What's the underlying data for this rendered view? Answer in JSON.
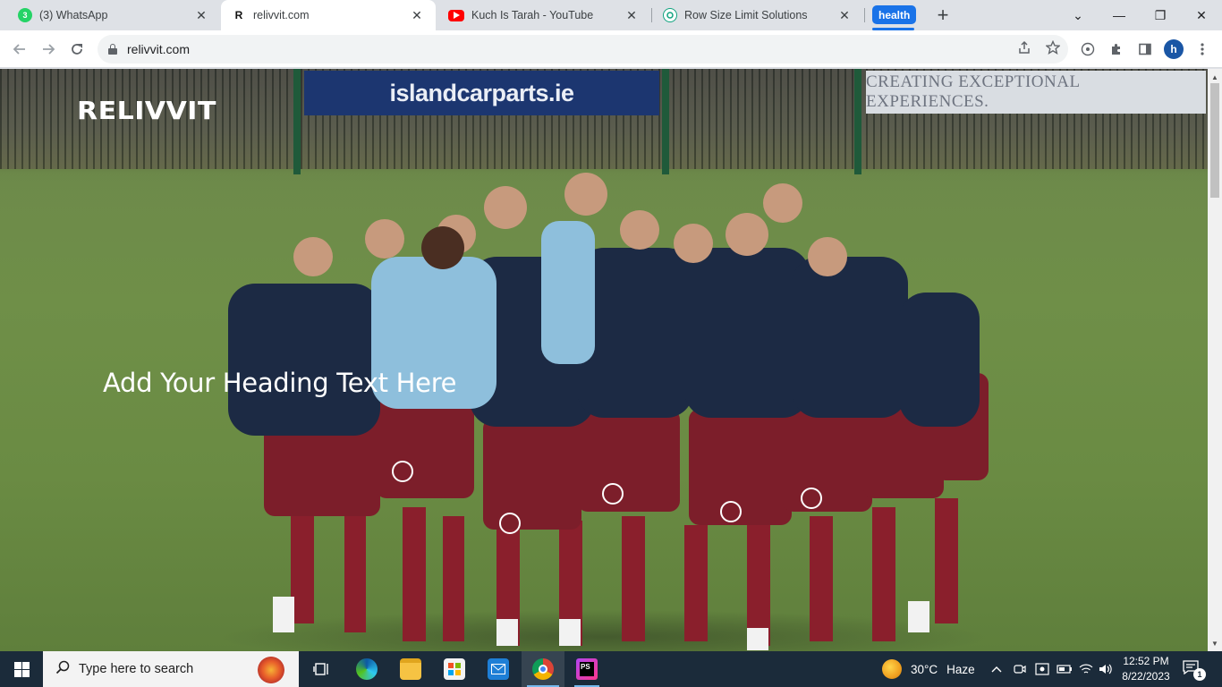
{
  "browser": {
    "tabs": [
      {
        "title": "(3) WhatsApp",
        "favicon": "whatsapp-icon",
        "badge": "3",
        "active": false
      },
      {
        "title": "relivvit.com",
        "favicon": "relivvit-icon",
        "badge": "R",
        "active": true
      },
      {
        "title": "Kuch Is Tarah - YouTube",
        "favicon": "youtube-icon",
        "badge": "",
        "active": false
      },
      {
        "title": "Row Size Limit Solutions",
        "favicon": "chatgpt-icon",
        "badge": "",
        "active": false
      }
    ],
    "tab_group_label": "health",
    "new_tab_label": "+",
    "close_glyph": "✕",
    "window_controls": {
      "tab_search": "⌄",
      "minimize": "—",
      "restore": "❐",
      "close": "✕"
    },
    "address": "relivvit.com",
    "profile_initial": "h",
    "accent": "#1a73e8"
  },
  "page": {
    "logo": "RELIVVIT",
    "heading": "Add Your Heading Text Here",
    "banner_left": "islandcarparts.ie",
    "banner_right": "CREATING EXCEPTIONAL EXPERIENCES."
  },
  "taskbar": {
    "search_placeholder": "Type here to search",
    "weather": {
      "temperature": "30°C",
      "condition": "Haze"
    },
    "clock": {
      "time": "12:52 PM",
      "date": "8/22/2023"
    },
    "notification_count": "1",
    "ps_label": "PS"
  }
}
